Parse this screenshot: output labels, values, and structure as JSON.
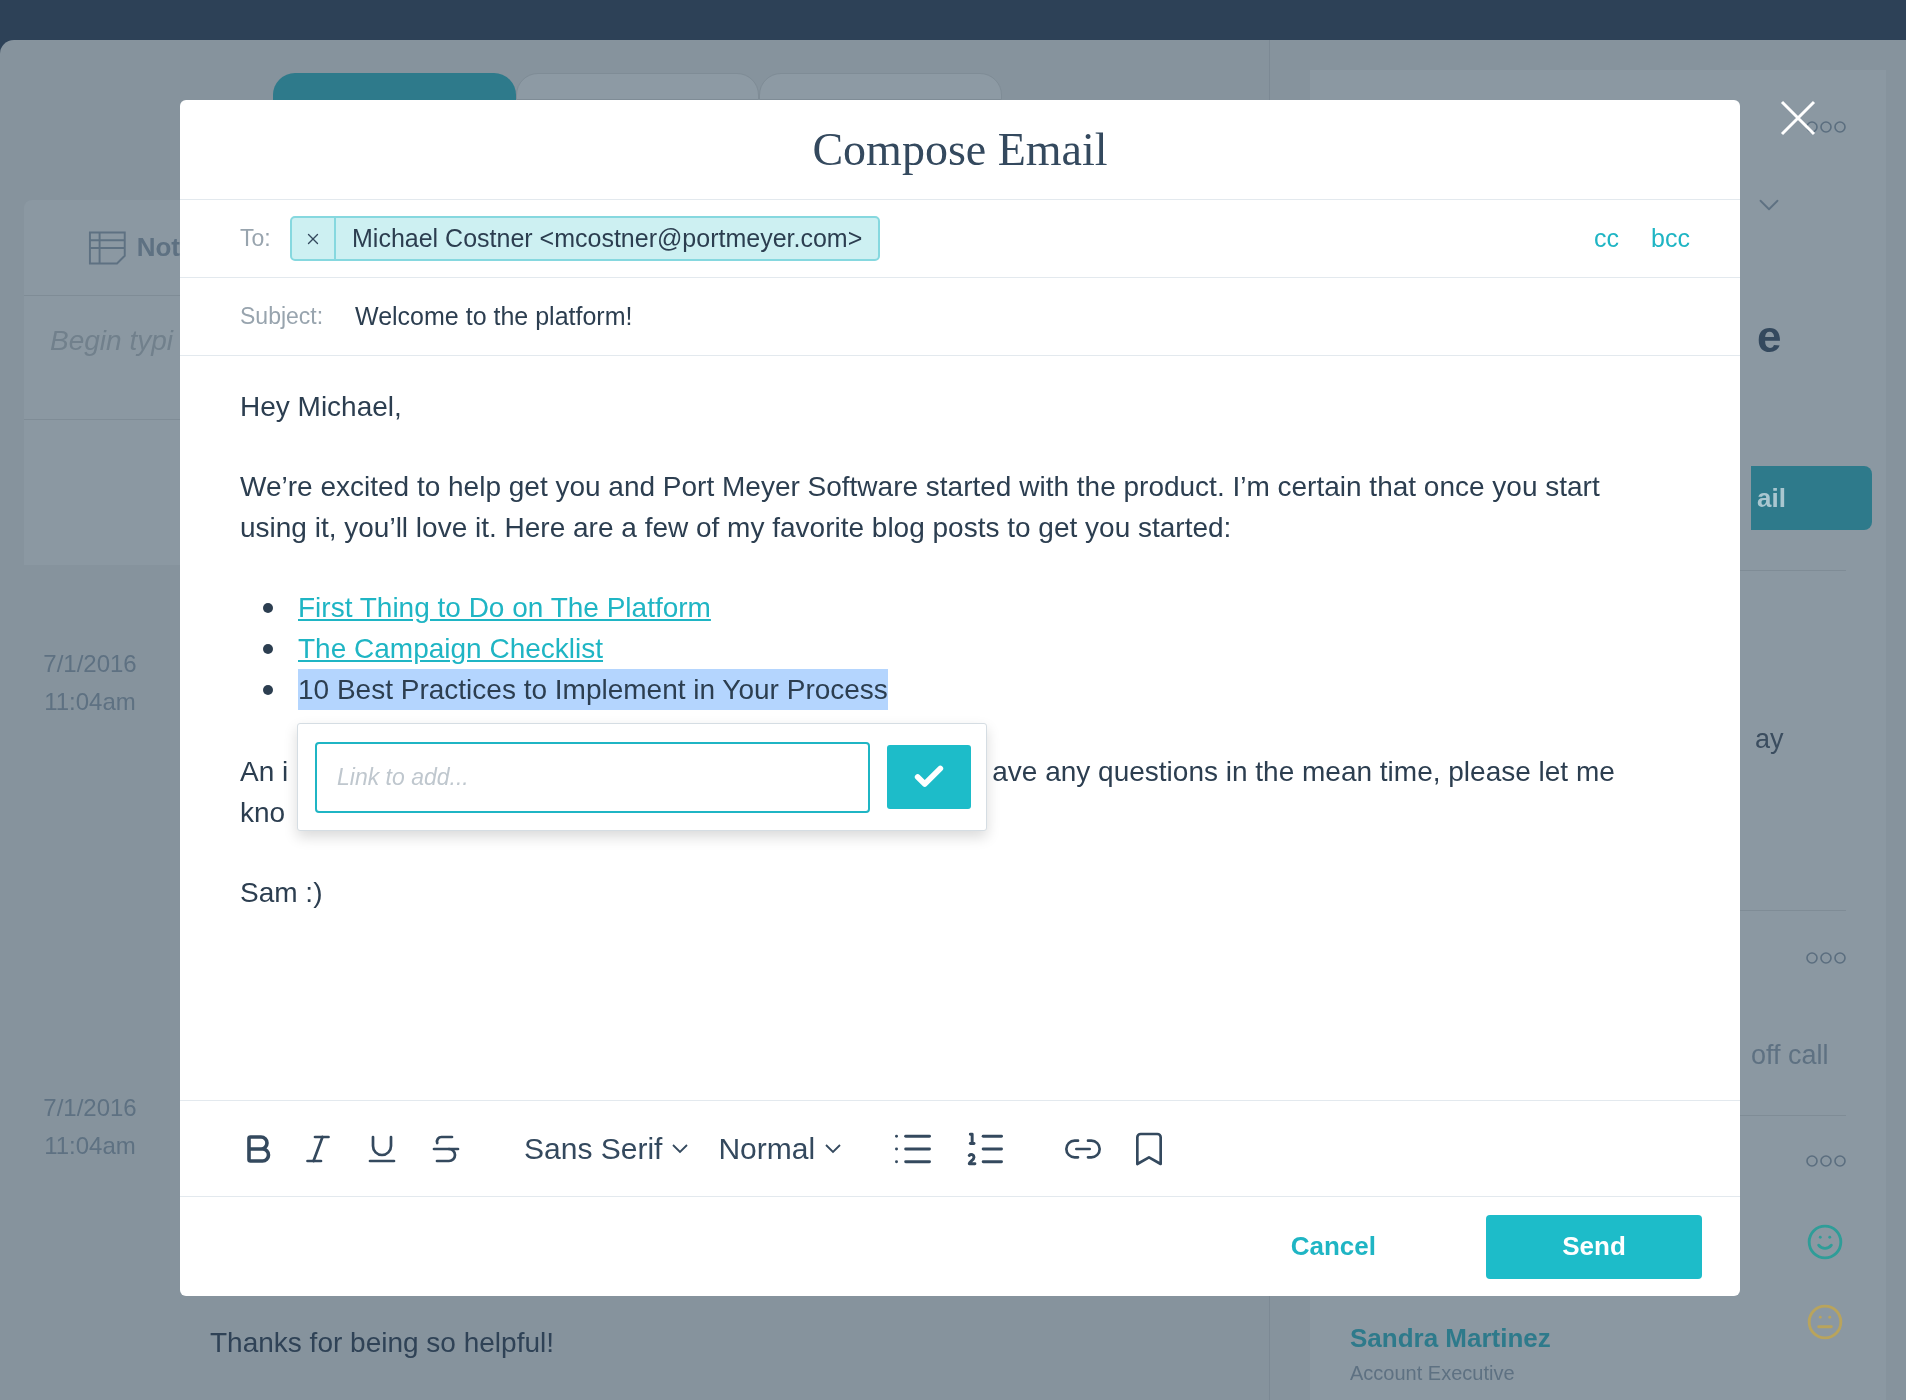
{
  "background": {
    "tabs": [
      {
        "selected": true
      },
      {
        "selected": false
      },
      {
        "selected": false
      }
    ],
    "notes_card": {
      "tab_label": "Not",
      "placeholder": "Begin typi"
    },
    "timeline": [
      {
        "date": "7/1/2016",
        "time": "11:04am"
      },
      {
        "date": "7/1/2016",
        "time": "11:04am"
      }
    ],
    "comment": "Thanks for being so helpful!",
    "side_panel": {
      "heading": "e",
      "button": "ail",
      "text_1": "ay",
      "text_2": "off call",
      "moods": [
        {
          "color": "#2f9d98"
        },
        {
          "color": "#b9a45c"
        }
      ],
      "contacts": [
        {
          "name": "Sandra Martinez",
          "role": "Account Executive"
        }
      ]
    }
  },
  "modal": {
    "title": "Compose Email",
    "to_label": "To:",
    "recipients": [
      {
        "text": "Michael Costner <mcostner@portmeyer.com>"
      }
    ],
    "cc": "cc",
    "bcc": "bcc",
    "subject_label": "Subject:",
    "subject": "Welcome to the platform!",
    "body": {
      "greeting": "Hey Michael,",
      "paragraph": "We’re excited to help get you and Port Meyer Software started with the product. I’m certain that once you start using it, you’ll love it. Here are a few of my favorite blog posts to get you started:",
      "list": [
        {
          "kind": "link",
          "text": "First Thing to Do on The Platform",
          "highlighted": false
        },
        {
          "kind": "link",
          "text": "The Campaign Checklist",
          "highlighted": false
        },
        {
          "kind": "text",
          "text": "10 Best Practices to Implement in Your Process",
          "highlighted": true
        }
      ],
      "paragraph_2_left": "An i",
      "paragraph_2_right": "ave any questions in the mean time, please let me",
      "paragraph_2_line_2": "kno",
      "signature": "Sam :)"
    },
    "link_popover": {
      "placeholder": "Link to add..."
    },
    "toolbar": {
      "font": "Sans Serif",
      "size": "Normal"
    },
    "cancel": "Cancel",
    "send": "Send"
  }
}
